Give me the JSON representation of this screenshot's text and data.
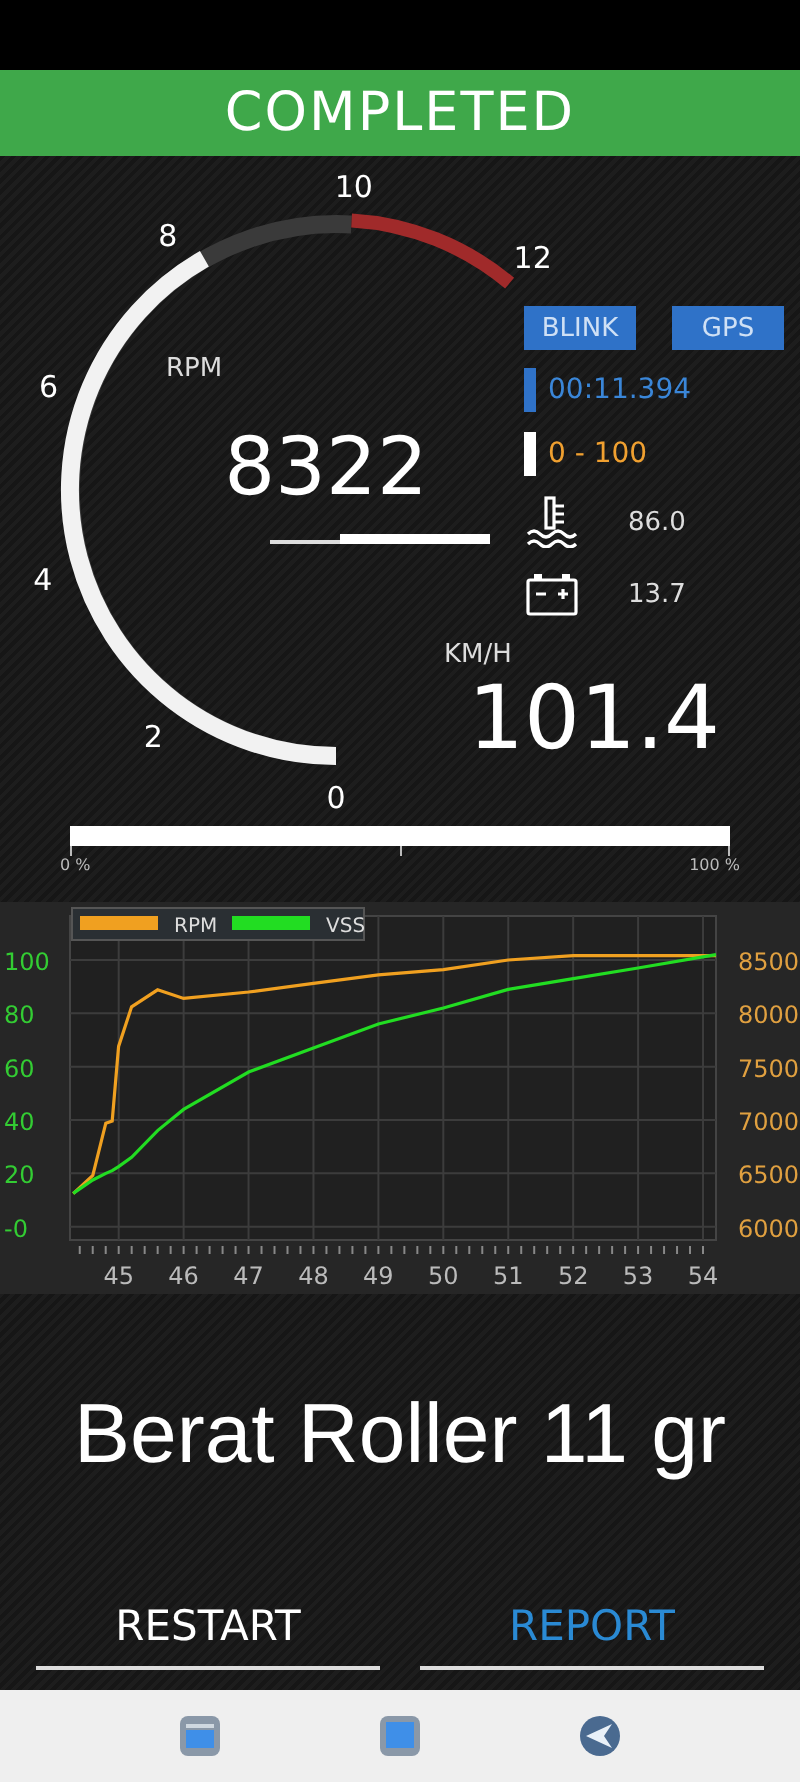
{
  "header": {
    "title": "COMPLETED"
  },
  "gauge": {
    "unit": "RPM",
    "value": "8322",
    "labels": [
      "0",
      "2",
      "4",
      "6",
      "8",
      "10",
      "12"
    ]
  },
  "buttons": [
    {
      "label": "BLINK"
    },
    {
      "label": "GPS"
    }
  ],
  "readouts": [
    {
      "kind": "timer",
      "text": "00:11.394",
      "color": "#2f72c8"
    },
    {
      "kind": "range",
      "text": "0 - 100",
      "color": "#ffffff"
    }
  ],
  "sensors": [
    {
      "kind": "coolant",
      "value": "86.0"
    },
    {
      "kind": "battery",
      "value": "13.7"
    }
  ],
  "speed": {
    "unit": "KM/H",
    "value": "101.4"
  },
  "progress": {
    "level": 1,
    "start_label": "0 %",
    "end_label": "100 %"
  },
  "chart": {
    "chart_data": {
      "type": "line",
      "grid": true,
      "legend": "top-left",
      "xlim": [
        44.25,
        54.2
      ],
      "ylim": [
        -5,
        116.5
      ],
      "xticks": [
        45,
        46,
        47,
        48,
        49,
        50,
        51,
        52,
        53,
        54
      ],
      "yticks": [
        {
          "value": 0,
          "label": "-0"
        },
        20,
        40,
        60,
        80,
        100
      ],
      "y2lim": [
        5875,
        8912
      ],
      "y2ticks": [
        6000,
        6500,
        7000,
        7500,
        8000,
        8500
      ],
      "x": [
        44.3,
        44.6,
        44.8,
        44.9,
        45.0,
        45.2,
        45.6,
        46.0,
        47,
        48,
        49,
        50,
        51,
        52,
        53,
        54.2
      ],
      "series": [
        {
          "name": "RPM",
          "color": "#f0a020",
          "axis": "y2",
          "values": [
            6310,
            6480,
            6970,
            6990,
            7690,
            8060,
            8220,
            8140,
            8200,
            8280,
            8360,
            8410,
            8500,
            8540,
            8540,
            8540
          ]
        },
        {
          "name": "VSS",
          "color": "#22dd22",
          "values": [
            12.5,
            17.5,
            20,
            21,
            22.5,
            26,
            36,
            44,
            58,
            67,
            76,
            82,
            89,
            93,
            97,
            102
          ]
        }
      ]
    }
  },
  "note": "Berat Roller 11 gr",
  "actions": [
    {
      "label": "RESTART",
      "selected": false
    },
    {
      "label": "REPORT",
      "selected": true
    }
  ],
  "nav": [
    {
      "kind": "recent"
    },
    {
      "kind": "home"
    },
    {
      "kind": "back"
    }
  ]
}
